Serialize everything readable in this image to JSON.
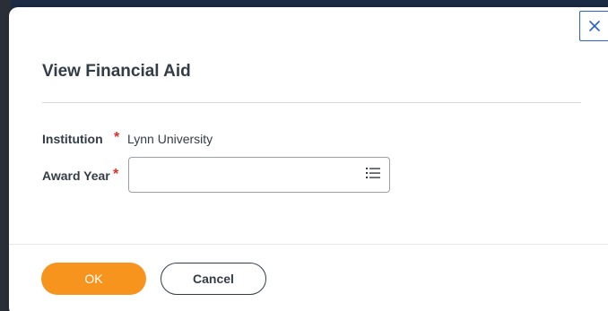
{
  "dialog": {
    "title": "View Financial Aid",
    "close_icon": "close-icon",
    "fields": {
      "institution": {
        "label": "Institution",
        "required_mark": "*",
        "value": "Lynn University"
      },
      "award_year": {
        "label": "Award Year",
        "required_mark": "*",
        "value": "",
        "placeholder": "",
        "icon": "list-icon"
      }
    },
    "buttons": {
      "ok_label": "OK",
      "cancel_label": "Cancel"
    }
  },
  "colors": {
    "accent_orange": "#f7941e",
    "required_red": "#de2e21",
    "close_blue": "#2a62c9",
    "text_dark": "#333d47"
  }
}
